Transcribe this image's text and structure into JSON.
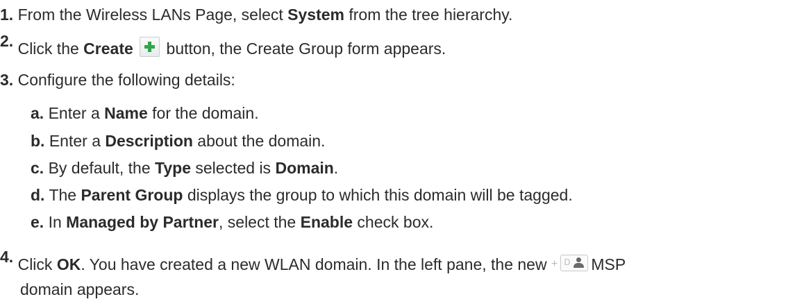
{
  "steps": [
    {
      "num": "1.",
      "parts": [
        "From the Wireless LANs Page, select ",
        "System",
        " from the tree hierarchy."
      ]
    },
    {
      "num": "2.",
      "parts": [
        "Click the ",
        "Create",
        " button, the Create Group form appears."
      ]
    },
    {
      "num": "3.",
      "parts": [
        "Configure the following details:"
      ]
    },
    {
      "num": "4.",
      "parts": [
        "Click ",
        "OK",
        ". You have created a new WLAN domain. In the left pane, the new ",
        "MSP",
        "domain appears."
      ]
    }
  ],
  "substeps": [
    {
      "letter": "a.",
      "parts": [
        "Enter a ",
        "Name",
        " for the domain."
      ]
    },
    {
      "letter": "b.",
      "parts": [
        "Enter a ",
        "Description",
        " about the domain."
      ]
    },
    {
      "letter": "c.",
      "parts": [
        "By default, the ",
        "Type",
        " selected is ",
        "Domain",
        "."
      ]
    },
    {
      "letter": "d.",
      "parts": [
        "The ",
        "Parent Group",
        " displays the group to which this domain will be tagged."
      ]
    },
    {
      "letter": "e.",
      "parts": [
        "In ",
        "Managed by Partner",
        ", select the ",
        "Enable",
        " check box."
      ]
    }
  ],
  "icons": {
    "create": "create-plus-icon",
    "msp_plus": "+",
    "msp_domain": "msp-domain-icon",
    "msp_letter": "D"
  },
  "colors": {
    "create_plus": "#2fa64b",
    "text": "#2b2b2b"
  }
}
